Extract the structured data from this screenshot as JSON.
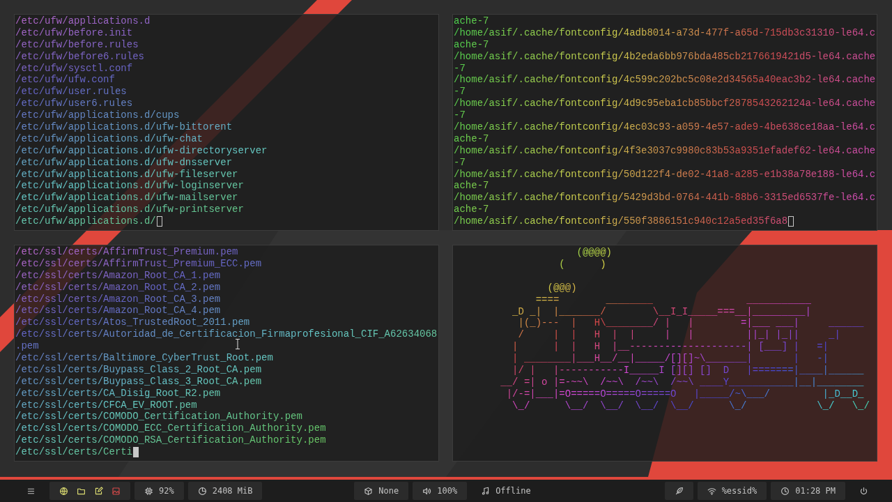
{
  "panes": [
    {
      "kind": "terminal",
      "focused": false,
      "lines": [
        "/etc/ufw/applications.d",
        "/etc/ufw/before.init",
        "/etc/ufw/before.rules",
        "/etc/ufw/before6.rules",
        "/etc/ufw/sysctl.conf",
        "/etc/ufw/ufw.conf",
        "/etc/ufw/user.rules",
        "/etc/ufw/user6.rules",
        "/etc/ufw/applications.d/cups",
        "/etc/ufw/applications.d/ufw-bittorent",
        "/etc/ufw/applications.d/ufw-chat",
        "/etc/ufw/applications.d/ufw-directoryserver",
        "/etc/ufw/applications.d/ufw-dnsserver",
        "/etc/ufw/applications.d/ufw-fileserver",
        "/etc/ufw/applications.d/ufw-loginserver",
        "/etc/ufw/applications.d/ufw-mailserver",
        "/etc/ufw/applications.d/ufw-printserver",
        "/etc/ufw/applications.d/"
      ]
    },
    {
      "kind": "terminal",
      "focused": false,
      "lines": [
        "ache-7",
        "/home/asif/.cache/fontconfig/4adb8014-a73d-477f-a65d-715db3c31310-le64.c",
        "ache-7",
        "/home/asif/.cache/fontconfig/4b2eda6bb976bda485cb2176619421d5-le64.cache",
        "-7",
        "/home/asif/.cache/fontconfig/4c599c202bc5c08e2d34565a40eac3b2-le64.cache",
        "-7",
        "/home/asif/.cache/fontconfig/4d9c95eba1cb85bbcf2878543262124a-le64.cache",
        "-7",
        "/home/asif/.cache/fontconfig/4ec03c93-a059-4e57-ade9-4be638ce18aa-le64.c",
        "ache-7",
        "/home/asif/.cache/fontconfig/4f3e3037c9980c83b53a9351efadef62-le64.cache",
        "-7",
        "/home/asif/.cache/fontconfig/50d122f4-de02-41a8-a285-e1b38a78e188-le64.c",
        "ache-7",
        "/home/asif/.cache/fontconfig/5429d3bd-0764-441b-88b6-3315ed6537fe-le64.c",
        "ache-7",
        "/home/asif/.cache/fontconfig/550f3886151c940c12a5ed35f6a8"
      ]
    },
    {
      "kind": "terminal",
      "focused": true,
      "lines": [
        "/etc/ssl/certs/AffirmTrust_Premium.pem",
        "/etc/ssl/certs/AffirmTrust_Premium_ECC.pem",
        "/etc/ssl/certs/Amazon_Root_CA_1.pem",
        "/etc/ssl/certs/Amazon_Root_CA_2.pem",
        "/etc/ssl/certs/Amazon_Root_CA_3.pem",
        "/etc/ssl/certs/Amazon_Root_CA_4.pem",
        "/etc/ssl/certs/Atos_TrustedRoot_2011.pem",
        "/etc/ssl/certs/Autoridad_de_Certificacion_Firmaprofesional_CIF_A62634068",
        ".pem",
        "/etc/ssl/certs/Baltimore_CyberTrust_Root.pem",
        "/etc/ssl/certs/Buypass_Class_2_Root_CA.pem",
        "/etc/ssl/certs/Buypass_Class_3_Root_CA.pem",
        "/etc/ssl/certs/CA_Disig_Root_R2.pem",
        "/etc/ssl/certs/CFCA_EV_ROOT.pem",
        "/etc/ssl/certs/COMODO_Certification_Authority.pem",
        "/etc/ssl/certs/COMODO_ECC_Certification_Authority.pem",
        "/etc/ssl/certs/COMODO_RSA_Certification_Authority.pem",
        "/etc/ssl/certs/Certi"
      ]
    },
    {
      "kind": "art",
      "art": "                     (@@@@)\n                  (      )\n\n                (@@@)\n              ====        ________                ___________\n          _D _|  |_______/        \\__I_I_____===__|_________|\n           |(_)---  |   H\\________/ |   |        =|___ ___|     ______\n           /     |  |   H  |  |     |   |         ||_| |_||     _|\n          |      |  |   H  |__--------------------| [___] |   =|\n          | ________|___H__/__|_____/[][]~\\_______|       |   -|\n          |/ |   |-----------I_____I [][] []  D   |=======|____|______\n        __/ =| o |=-~~\\  /~~\\  /~~\\  /~~\\ ____Y___________|__|________\n         |/-=|___|=O=====O=====O=====O   |_____/~\\___/         |_D__D_\n          \\_/      \\__/  \\__/  \\__/  \\__/      \\_/            \\_/   \\_/"
    }
  ],
  "status_bar": {
    "left": [
      {
        "kind": "menu"
      },
      {
        "kind": "launchers"
      },
      {
        "kind": "cpu",
        "text": "92%"
      },
      {
        "kind": "memory",
        "text": "2408 MiB"
      }
    ],
    "center": [
      {
        "kind": "package",
        "text": "None"
      },
      {
        "kind": "volume",
        "text": "100%"
      },
      {
        "kind": "music",
        "text": "Offline"
      }
    ],
    "right": [
      {
        "kind": "feather"
      },
      {
        "kind": "wifi",
        "text": "%essid%"
      },
      {
        "kind": "clock",
        "text": "01:28 PM"
      },
      {
        "kind": "power"
      }
    ]
  }
}
